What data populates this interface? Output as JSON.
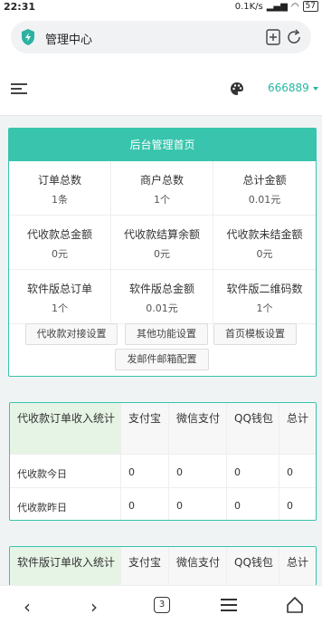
{
  "status": {
    "time": "22:31",
    "net": "0.1K/s",
    "battery": "57"
  },
  "browser": {
    "url_title": "管理中心"
  },
  "header": {
    "username": "666889"
  },
  "dashboard": {
    "title": "后台管理首页",
    "stats": [
      {
        "label": "订单总数",
        "value": "1条"
      },
      {
        "label": "商户总数",
        "value": "1个"
      },
      {
        "label": "总计金额",
        "value": "0.01元"
      },
      {
        "label": "代收款总金额",
        "value": "0元"
      },
      {
        "label": "代收款结算余额",
        "value": "0元"
      },
      {
        "label": "代收款未结金额",
        "value": "0元"
      },
      {
        "label": "软件版总订单",
        "value": "1个"
      },
      {
        "label": "软件版总金额",
        "value": "0.01元"
      },
      {
        "label": "软件版二维码数",
        "value": "1个"
      }
    ],
    "buttons": [
      "代收款对接设置",
      "其他功能设置",
      "首页模板设置",
      "发邮件邮箱配置"
    ]
  },
  "table1": {
    "headers": [
      "代收款订单收入统计",
      "支付宝",
      "微信支付",
      "QQ钱包",
      "总计"
    ],
    "rows": [
      [
        "代收款今日",
        "0",
        "0",
        "0",
        "0"
      ],
      [
        "代收款昨日",
        "0",
        "0",
        "0",
        "0"
      ]
    ]
  },
  "table2": {
    "headers": [
      "软件版订单收入统计",
      "支付宝",
      "微信支付",
      "QQ钱包",
      "总计"
    ]
  },
  "nav": {
    "tab_count": "3"
  }
}
